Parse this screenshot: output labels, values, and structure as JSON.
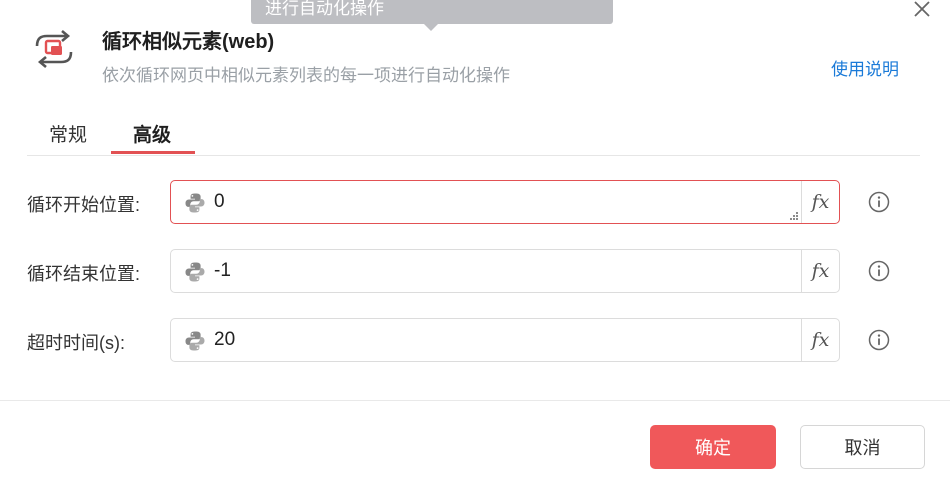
{
  "tooltip": {
    "text": "进行自动化操作"
  },
  "header": {
    "title": "循环相似元素(web)",
    "subtitle": "依次循环网页中相似元素列表的每一项进行自动化操作",
    "help_link": "使用说明",
    "icon": "loop-elements-icon"
  },
  "tabs": [
    {
      "label": "常规",
      "active": false
    },
    {
      "label": "高级",
      "active": true
    }
  ],
  "fields": [
    {
      "label": "循环开始位置:",
      "value": "0",
      "mode_icon": "python-icon",
      "expr_label": "fx"
    },
    {
      "label": "循环结束位置:",
      "value": "-1",
      "mode_icon": "python-icon",
      "expr_label": "fx"
    },
    {
      "label": "超时时间(s):",
      "value": "20",
      "mode_icon": "python-icon",
      "expr_label": "fx"
    }
  ],
  "footer": {
    "ok_label": "确定",
    "cancel_label": "取消"
  },
  "colors": {
    "accent": "#e25153",
    "primary_button": "#f0585a",
    "link": "#1a7ad8"
  }
}
